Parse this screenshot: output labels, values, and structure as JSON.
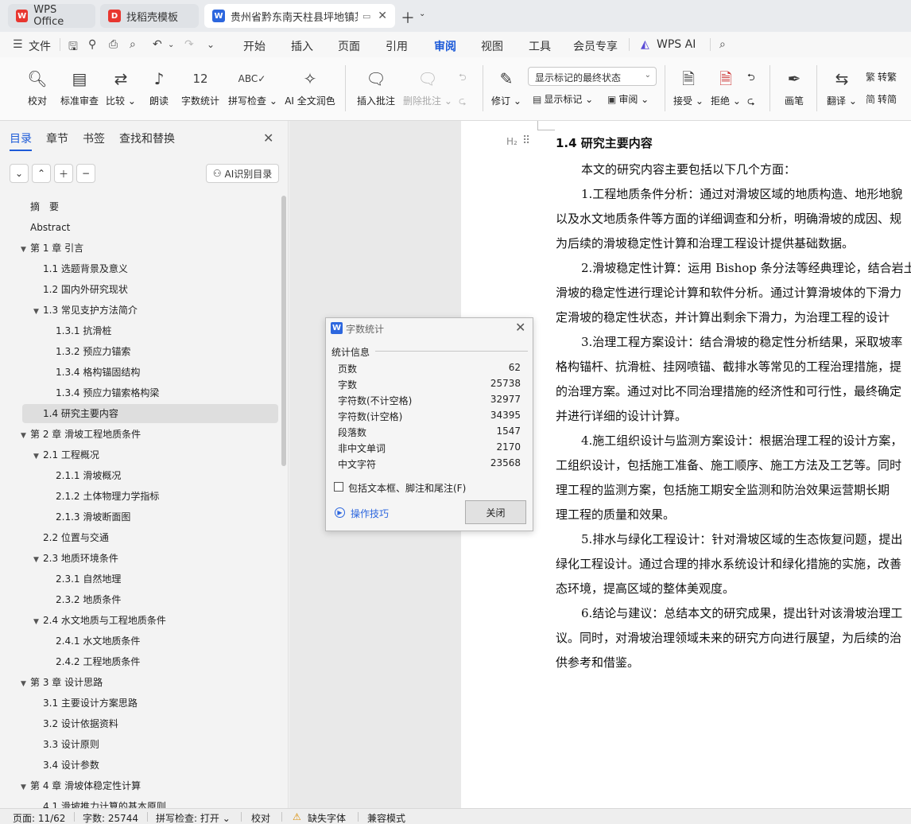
{
  "tabs": [
    {
      "label": "WPS Office",
      "icon": "wps-logo-icon",
      "color": "#e8362f"
    },
    {
      "label": "找稻壳模板",
      "icon": "docer-logo-icon",
      "color": "#e8362f"
    },
    {
      "label": "贵州省黔东南天柱县坪地镇某",
      "icon": "word-doc-icon",
      "color": "#2c66de"
    }
  ],
  "menu": {
    "file": "文件",
    "items": [
      "开始",
      "插入",
      "页面",
      "引用",
      "审阅",
      "视图",
      "工具",
      "会员专享"
    ],
    "active": "审阅",
    "wps_ai": "WPS AI"
  },
  "ribbon": {
    "proofread": "校对",
    "standard_review": "标准审查",
    "compare": "比较",
    "read_aloud": "朗读",
    "word_count": "字数统计",
    "spell_check": "拼写检查",
    "ai_polish": "AI 全文润色",
    "insert_comment": "插入批注",
    "delete_comment": "删除批注",
    "revise": "修订",
    "markup_mode": "显示标记的最终状态",
    "show_markup": "显示标记",
    "review": "审阅",
    "accept": "接受",
    "reject": "拒绝",
    "pen": "画笔",
    "translate": "翻译",
    "to_traditional": "转繁",
    "to_simplified": "转简"
  },
  "nav": {
    "tabs": [
      "目录",
      "章节",
      "书签",
      "查找和替换"
    ],
    "active_tab": "目录",
    "ai_toc": "AI识别目录",
    "toc": [
      {
        "label": "摘　要",
        "level": 0,
        "caret": false
      },
      {
        "label": "Abstract",
        "level": 0,
        "caret": false
      },
      {
        "label": "第 1 章  引言",
        "level": 0,
        "caret": true
      },
      {
        "label": "1.1 选题背景及意义",
        "level": 1,
        "caret": false
      },
      {
        "label": "1.2  国内外研究现状",
        "level": 1,
        "caret": false
      },
      {
        "label": "1.3 常见支护方法简介",
        "level": 1,
        "caret": true
      },
      {
        "label": "1.3.1  抗滑桩",
        "level": 2,
        "caret": false
      },
      {
        "label": "1.3.2  预应力锚索",
        "level": 2,
        "caret": false
      },
      {
        "label": "1.3.4  格构锚固结构",
        "level": 2,
        "caret": false
      },
      {
        "label": "1.3.4  预应力锚索格构梁",
        "level": 2,
        "caret": false
      },
      {
        "label": "1.4 研究主要内容",
        "level": 1,
        "caret": false,
        "selected": true
      },
      {
        "label": "第 2 章  滑坡工程地质条件",
        "level": 0,
        "caret": true
      },
      {
        "label": "2.1  工程概况",
        "level": 1,
        "caret": true
      },
      {
        "label": "2.1.1  滑坡概况",
        "level": 2,
        "caret": false
      },
      {
        "label": "2.1.2  土体物理力学指标",
        "level": 2,
        "caret": false
      },
      {
        "label": "2.1.3  滑坡断面图",
        "level": 2,
        "caret": false
      },
      {
        "label": "2.2  位置与交通",
        "level": 1,
        "caret": false
      },
      {
        "label": "2.3 地质环境条件",
        "level": 1,
        "caret": true
      },
      {
        "label": "2.3.1 自然地理",
        "level": 2,
        "caret": false
      },
      {
        "label": "2.3.2 地质条件",
        "level": 2,
        "caret": false
      },
      {
        "label": "2.4 水文地质与工程地质条件",
        "level": 1,
        "caret": true
      },
      {
        "label": "2.4.1 水文地质条件",
        "level": 2,
        "caret": false
      },
      {
        "label": "2.4.2 工程地质条件",
        "level": 2,
        "caret": false
      },
      {
        "label": "第 3 章  设计思路",
        "level": 0,
        "caret": true
      },
      {
        "label": "3.1  主要设计方案思路",
        "level": 1,
        "caret": false
      },
      {
        "label": "3.2  设计依据资料",
        "level": 1,
        "caret": false
      },
      {
        "label": "3.3 设计原则",
        "level": 1,
        "caret": false
      },
      {
        "label": "3.4 设计参数",
        "level": 1,
        "caret": false
      },
      {
        "label": "第 4 章  滑坡体稳定性计算",
        "level": 0,
        "caret": true
      },
      {
        "label": "4.1  滑坡推力计算的基本原则",
        "level": 1,
        "caret": false
      }
    ]
  },
  "document": {
    "heading_marker": "H₂",
    "heading": "1.4 研究主要内容",
    "lines": [
      {
        "text": "本文的研究内容主要包括以下几个方面：",
        "indent": true
      },
      {
        "text": "1.工程地质条件分析：通过对滑坡区域的地质构造、地形地貌",
        "indent": true
      },
      {
        "text": "以及水文地质条件等方面的详细调查和分析，明确滑坡的成因、规",
        "indent": false
      },
      {
        "text": "为后续的滑坡稳定性计算和治理工程设计提供基础数据。",
        "indent": false
      },
      {
        "text": "2.滑坡稳定性计算：运用 Bishop 条分法等经典理论，结合岩土",
        "indent": true
      },
      {
        "text": "滑坡的稳定性进行理论计算和软件分析。通过计算滑坡体的下滑力",
        "indent": false
      },
      {
        "text": "定滑坡的稳定性状态，并计算出剩余下滑力，为治理工程的设计",
        "indent": false
      },
      {
        "text": "3.治理工程方案设计：结合滑坡的稳定性分析结果，采取坡率",
        "indent": true
      },
      {
        "text": "格构锚杆、抗滑桩、挂网喷锚、截排水等常见的工程治理措施，提",
        "indent": false
      },
      {
        "text": "的治理方案。通过对比不同治理措施的经济性和可行性，最终确定",
        "indent": false
      },
      {
        "text": "并进行详细的设计计算。",
        "indent": false
      },
      {
        "text": "4.施工组织设计与监测方案设计：根据治理工程的设计方案，",
        "indent": true
      },
      {
        "text": "工组织设计，包括施工准备、施工顺序、施工方法及工艺等。同时",
        "indent": false
      },
      {
        "text": "理工程的监测方案，包括施工期安全监测和防治效果运营期长期",
        "indent": false
      },
      {
        "text": "理工程的质量和效果。",
        "indent": false
      },
      {
        "text": "5.排水与绿化工程设计：针对滑坡区域的生态恢复问题，提出",
        "indent": true
      },
      {
        "text": "绿化工程设计。通过合理的排水系统设计和绿化措施的实施，改善",
        "indent": false
      },
      {
        "text": "态环境，提高区域的整体美观度。",
        "indent": false
      },
      {
        "text": "6.结论与建议：总结本文的研究成果，提出针对该滑坡治理工",
        "indent": true
      },
      {
        "text": "议。同时，对滑坡治理领域未来的研究方向进行展望，为后续的治",
        "indent": false
      },
      {
        "text": "供参考和借鉴。",
        "indent": false
      }
    ]
  },
  "dialog": {
    "title": "字数统计",
    "section": "统计信息",
    "stats": [
      {
        "label": "页数",
        "value": "62"
      },
      {
        "label": "字数",
        "value": "25738"
      },
      {
        "label": "字符数(不计空格)",
        "value": "32977"
      },
      {
        "label": "字符数(计空格)",
        "value": "34395"
      },
      {
        "label": "段落数",
        "value": "1547"
      },
      {
        "label": "非中文单词",
        "value": "2170"
      },
      {
        "label": "中文字符",
        "value": "23568"
      }
    ],
    "include_label": "包括文本框、脚注和尾注(F)",
    "include_checked": false,
    "tips": "操作技巧",
    "close_label": "关闭"
  },
  "status": {
    "page": "页面: 11/62",
    "words": "字数: 25744",
    "spell": "拼写检查: 打开",
    "proof": "校对",
    "missing_font": "缺失字体",
    "compat": "兼容模式"
  }
}
